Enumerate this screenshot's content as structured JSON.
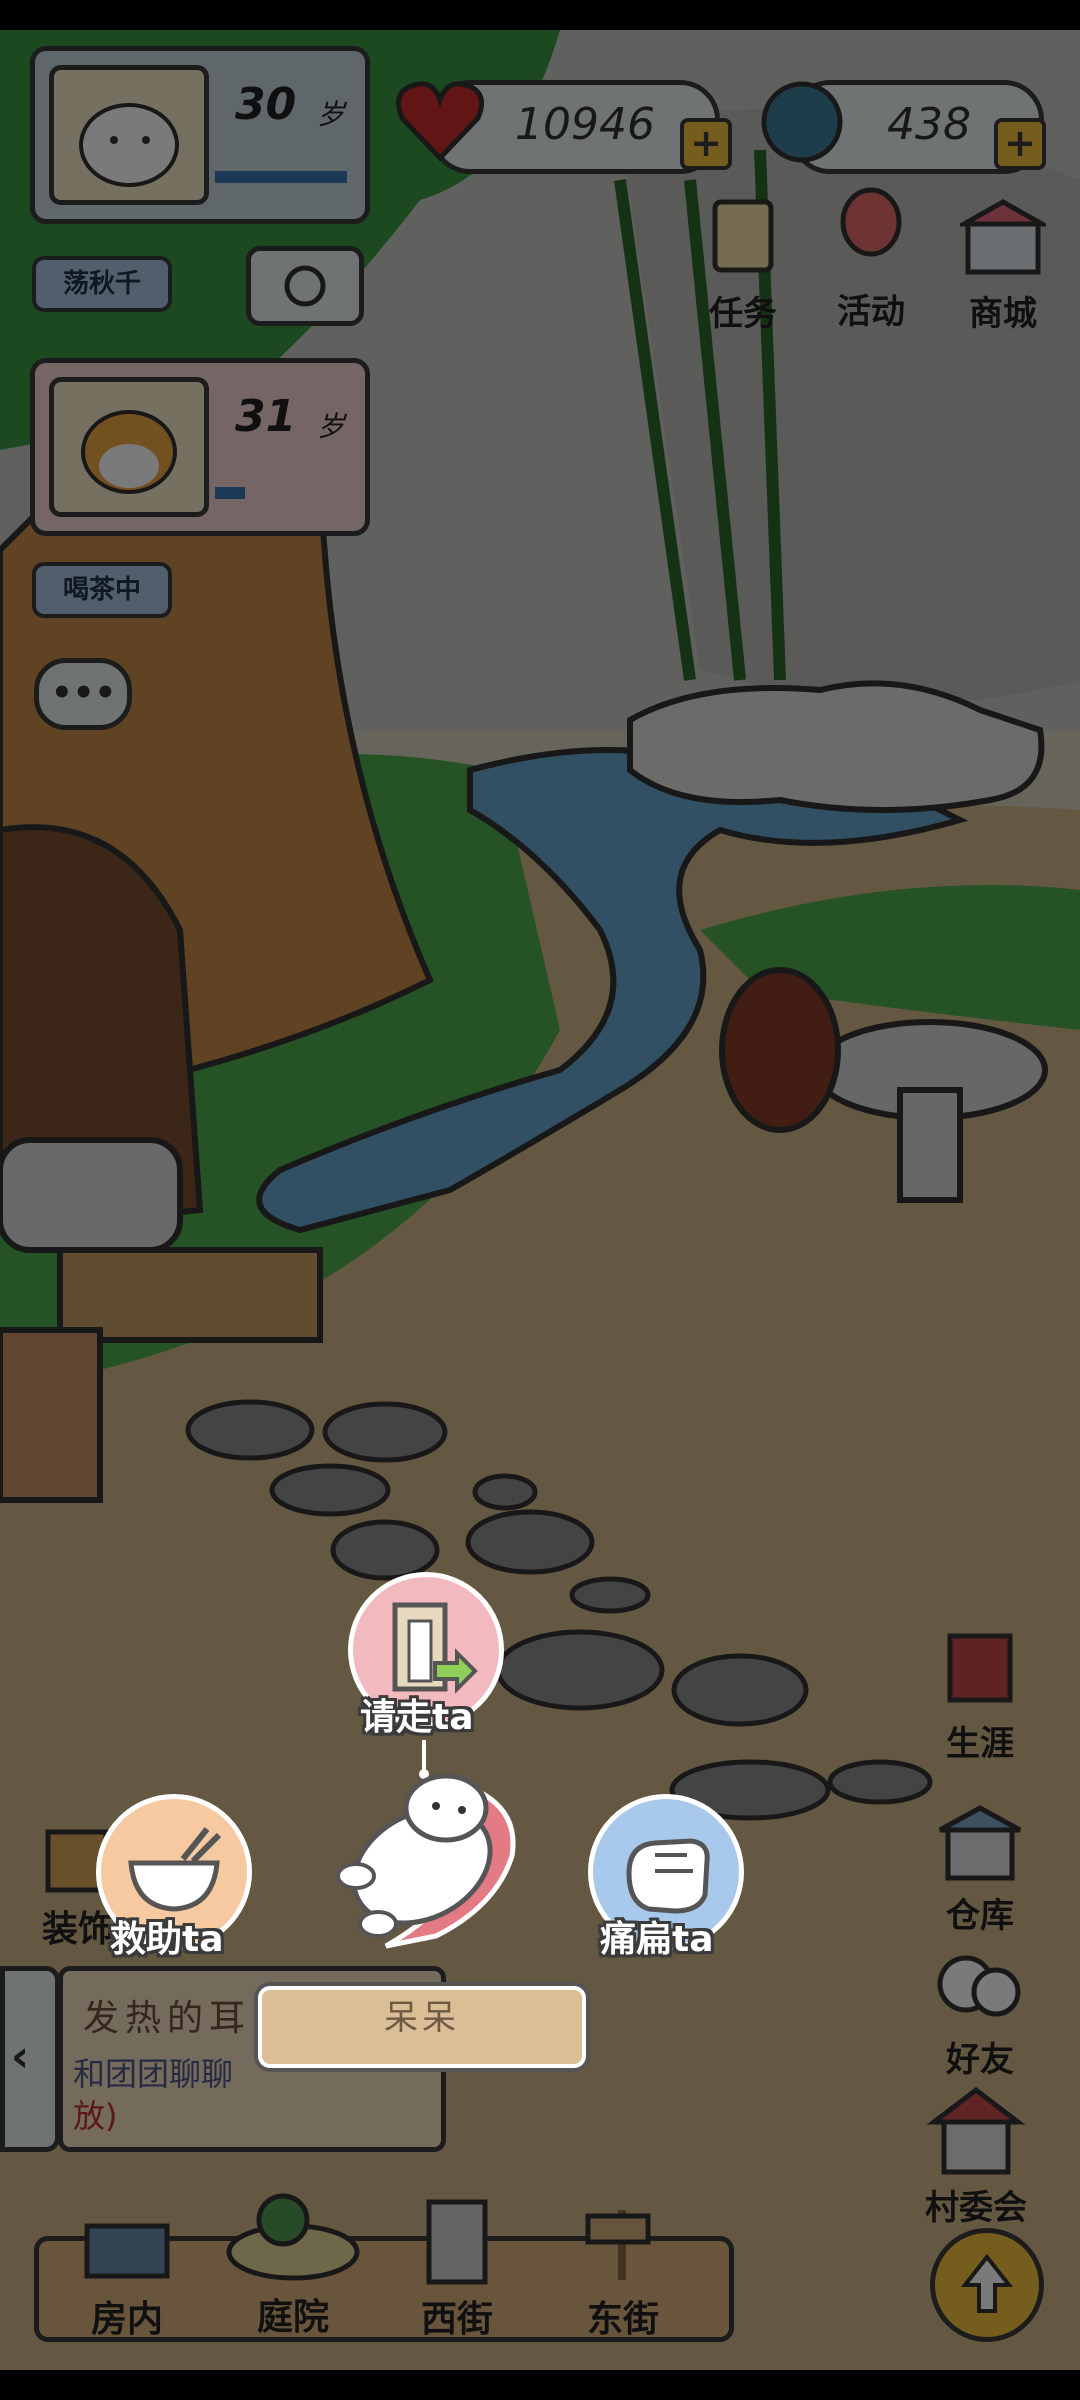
{
  "player_card": {
    "age": "30",
    "age_unit": "岁",
    "status": "荡秋千"
  },
  "partner_card": {
    "age": "31",
    "age_unit": "岁",
    "status": "喝茶中"
  },
  "resources": {
    "hearts": "10946",
    "gems": "438"
  },
  "top_buttons": [
    "任务",
    "活动",
    "商城"
  ],
  "side_buttons": [
    "生涯",
    "仓库",
    "好友",
    "村委会"
  ],
  "bottom_tabs": [
    "房内",
    "庭院",
    "西街",
    "东街"
  ],
  "decor_button": "装饰",
  "message_panel": {
    "title": "发热的耳",
    "line1": "和团团聊聊",
    "line2": "放)"
  },
  "actions": {
    "dismiss": "请走ta",
    "rescue": "救助ta",
    "beat": "痛扁ta"
  },
  "visitor_name": "呆呆",
  "colors": {
    "heart": "#cc2b2b",
    "gem": "#3f7f9c",
    "rescue_bg": "#f6c9a0",
    "dismiss_bg": "#f2b9bf",
    "beat_bg": "#a9c9ec",
    "plus": "#f3c43c"
  }
}
